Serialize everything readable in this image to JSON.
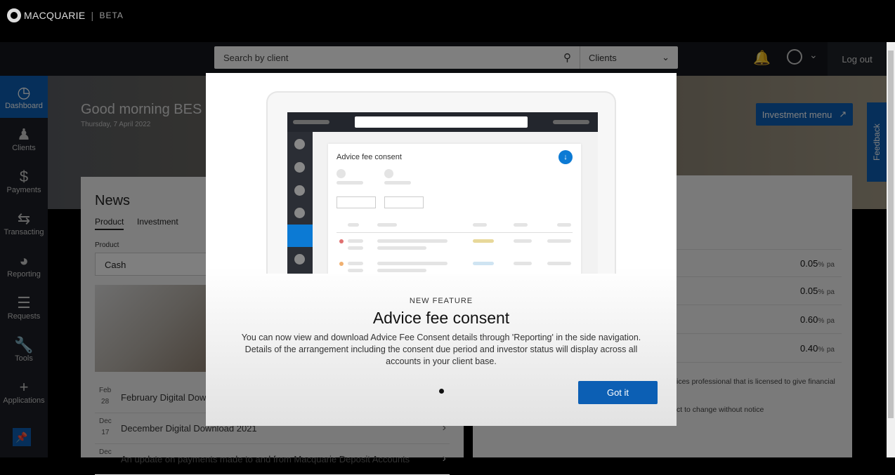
{
  "header": {
    "brand": "MACQUARIE",
    "beta": "BETA",
    "search_placeholder": "Search by client",
    "search_scope": "Clients",
    "logout": "Log out"
  },
  "sidebar": {
    "items": [
      {
        "label": "Dashboard",
        "icon": "gauge-icon"
      },
      {
        "label": "Clients",
        "icon": "org-chart-icon"
      },
      {
        "label": "Payments",
        "icon": "dollar-icon"
      },
      {
        "label": "Transacting",
        "icon": "arrows-icon"
      },
      {
        "label": "Reporting",
        "icon": "pie-chart-icon"
      },
      {
        "label": "Requests",
        "icon": "checklist-icon"
      },
      {
        "label": "Tools",
        "icon": "wrench-icon"
      },
      {
        "label": "Applications",
        "icon": "plus-icon"
      }
    ]
  },
  "hero": {
    "greeting": "Good morning BES",
    "date": "Thursday, 7 April 2022",
    "investment_menu": "Investment menu",
    "feedback": "Feedback"
  },
  "news": {
    "title": "News",
    "tabs": [
      "Product",
      "Investment"
    ],
    "product_label": "Product",
    "product_value": "Cash",
    "items": [
      {
        "month": "Feb",
        "day": "28",
        "title": "February Digital Download"
      },
      {
        "month": "Dec",
        "day": "17",
        "title": "December Digital Download 2021"
      },
      {
        "month": "Dec",
        "day": "",
        "title": "An update on payments made to and from Macquarie Deposit Accounts"
      }
    ]
  },
  "rates": [
    {
      "value": "0.05",
      "unit": "%",
      "suffix": "pa"
    },
    {
      "value": "0.05",
      "unit": "%",
      "suffix": "pa"
    },
    {
      "value": "0.60",
      "unit": "%",
      "suffix": "pa"
    },
    {
      "value": "0.40",
      "unit": "%",
      "suffix": "pa"
    }
  ],
  "disclaimers": [
    "ices professional that is licensed to give financial",
    "ct to change without notice"
  ],
  "modal": {
    "illustration_title": "Advice fee consent",
    "eyebrow": "NEW FEATURE",
    "title": "Advice fee consent",
    "body": "You can now view and download Advice Fee Consent details through 'Reporting' in the side navigation. Details of the arrangement including the consent due period and investor status will display across all accounts in your client base.",
    "button": "Got it"
  },
  "colors": {
    "accent": "#0c5fb4"
  }
}
